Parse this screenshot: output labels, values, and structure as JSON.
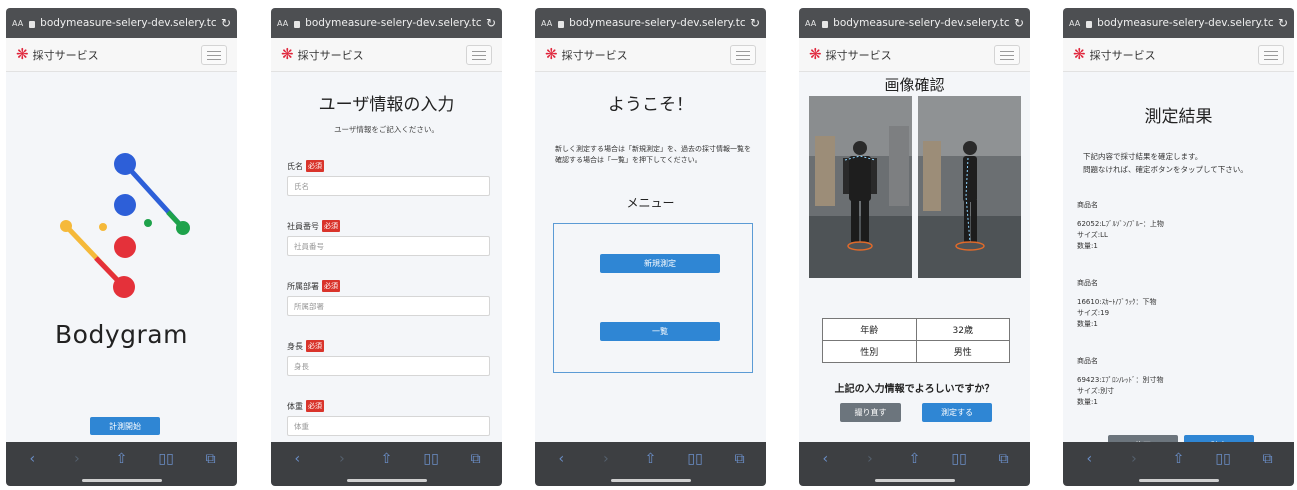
{
  "browser": {
    "text_size_label": "AA",
    "url": "bodymeasure-selery-dev.selery.tci-bo"
  },
  "app": {
    "brand": "採寸サービス"
  },
  "screen1": {
    "logo_text": "Bodygram",
    "start_button": "計測開始",
    "logo_colors": {
      "blue": "#2d5fd8",
      "red": "#e4313a",
      "green": "#1ea24b",
      "yellow": "#f5b93a"
    }
  },
  "screen2": {
    "title": "ユーザ情報の入力",
    "subtitle": "ユーザ情報をご記入ください。",
    "required_label": "必須",
    "fields": [
      {
        "label": "氏名",
        "placeholder": "氏名"
      },
      {
        "label": "社員番号",
        "placeholder": "社員番号"
      },
      {
        "label": "所属部署",
        "placeholder": "所属部署"
      },
      {
        "label": "身長",
        "placeholder": "身長"
      },
      {
        "label": "体重",
        "placeholder": "体重"
      }
    ]
  },
  "screen3": {
    "title": "ようこそ！",
    "description": "新しく測定する場合は「新規測定」を、過去の採寸情報一覧を確認する場合は「一覧」を押下してください。",
    "menu_title": "メニュー",
    "new_measure_button": "新規測定",
    "list_button": "一覧"
  },
  "screen4": {
    "title": "画像確認",
    "table": [
      {
        "label": "年齢",
        "value": "32歳"
      },
      {
        "label": "性別",
        "value": "男性"
      }
    ],
    "question": "上記の入力情報でよろしいですか？",
    "retake_button": "撮り直す",
    "measure_button": "測定する"
  },
  "screen5": {
    "title": "測定結果",
    "description_line1": "下記内容で採寸結果を確定します。",
    "description_line2": "問題なければ、確定ボタンをタップして下さい。",
    "product_label": "商品名",
    "products": [
      {
        "name": "62052:Lﾌﾞﾙｿﾞﾝ/ﾌﾞﾙｰ：上物",
        "size": "サイズ:LL",
        "qty": "数量:1"
      },
      {
        "name": "16610:ｽｶｰﾄ/ﾌﾞﾗｯｸ：下物",
        "size": "サイズ:19",
        "qty": "数量:1"
      },
      {
        "name": "69423:ｴﾌﾟﾛﾝ/ﾚｯﾄﾞ：別寸物",
        "size": "サイズ:別寸",
        "qty": "数量:1"
      }
    ],
    "fix_button": "修正",
    "confirm_button": "確定"
  },
  "toolbar_icons": [
    "back-icon",
    "forward-icon",
    "share-icon",
    "bookmarks-icon",
    "tabs-icon"
  ]
}
